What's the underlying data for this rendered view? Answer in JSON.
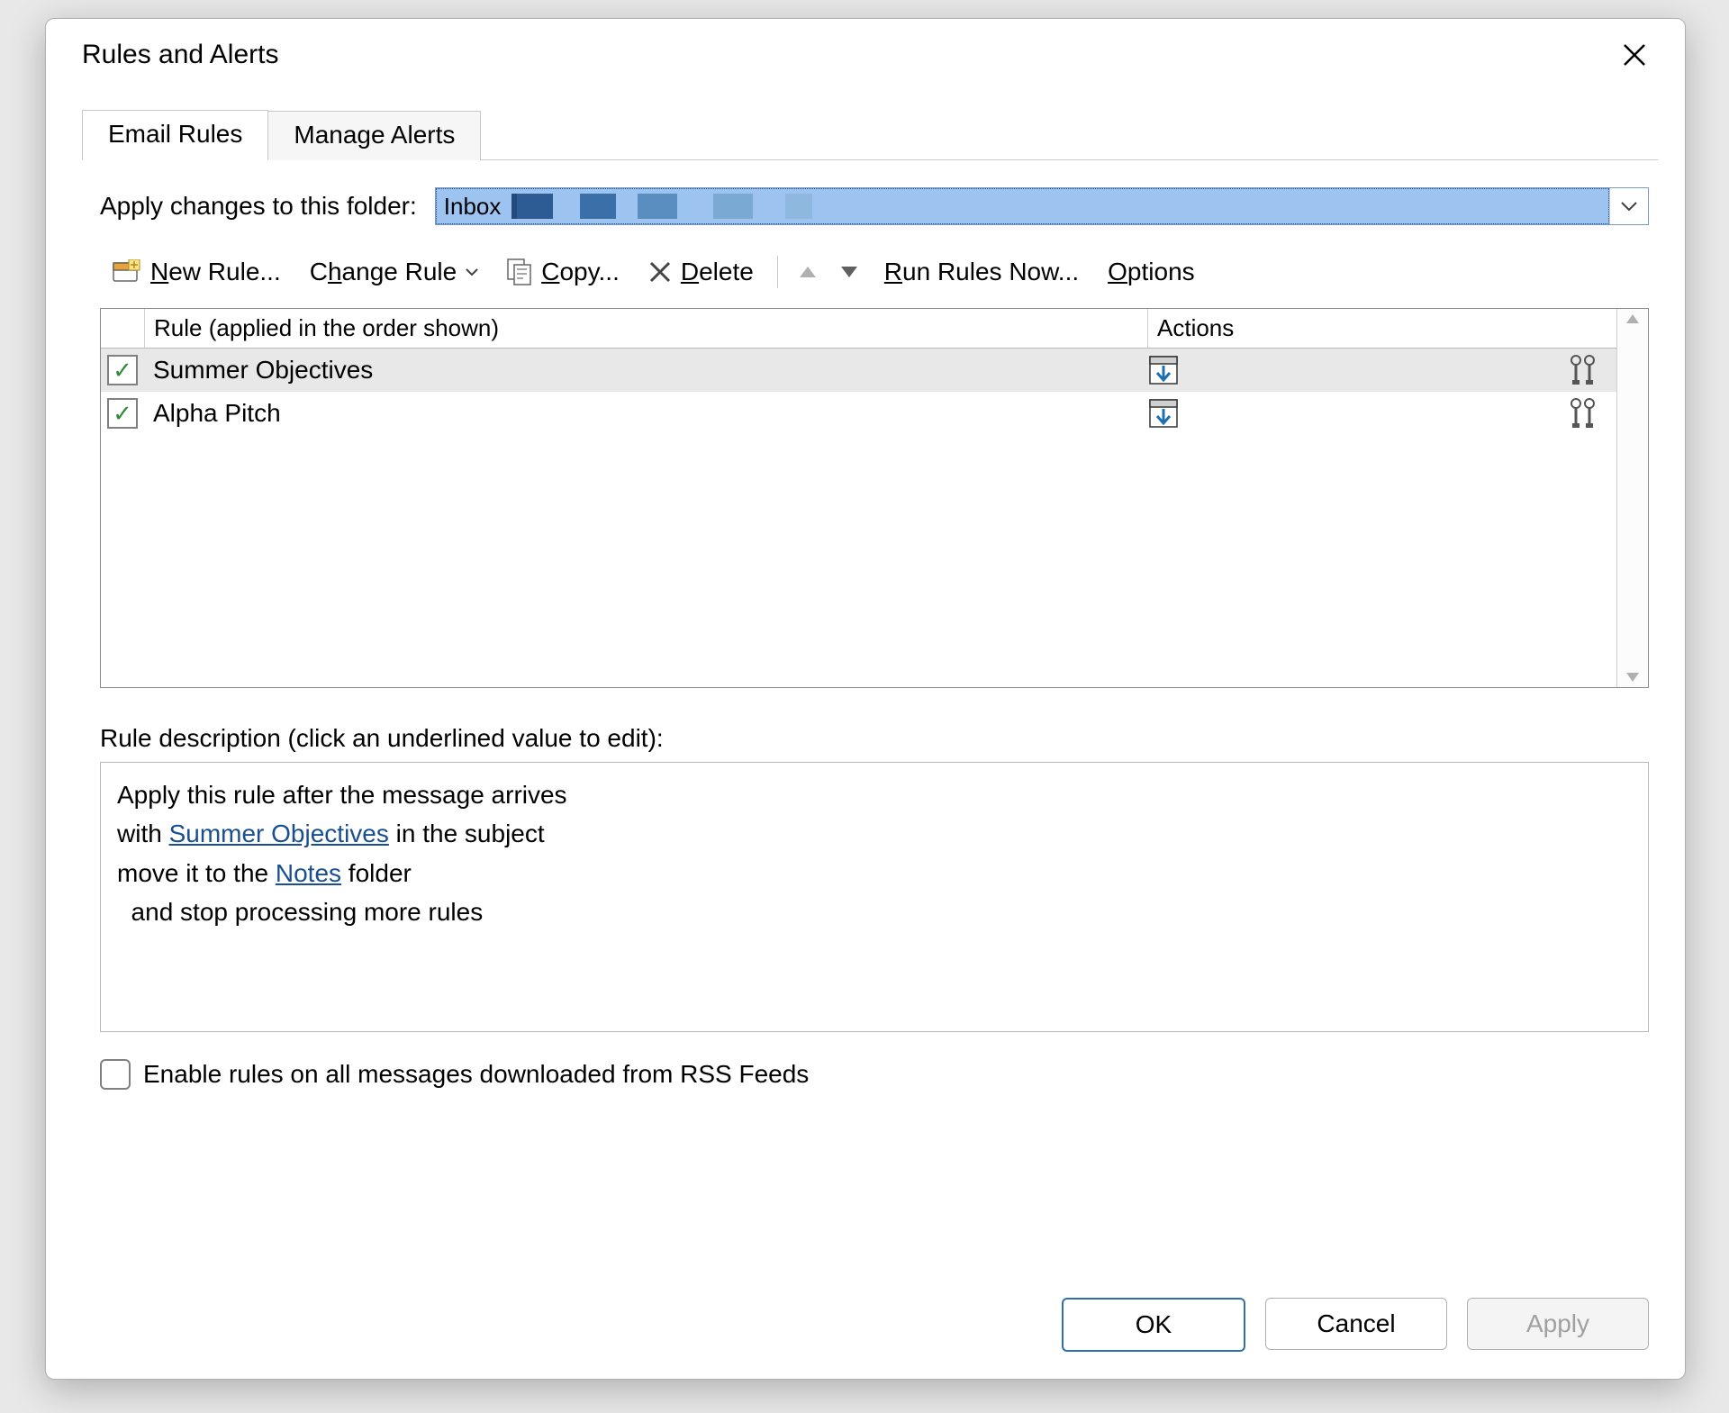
{
  "window": {
    "title": "Rules and Alerts"
  },
  "tabs": {
    "email_rules": "Email Rules",
    "manage_alerts": "Manage Alerts"
  },
  "folder_row": {
    "label": "Apply changes to this folder:",
    "selected": "Inbox"
  },
  "toolbar": {
    "new_rule": "New Rule...",
    "change_rule": "Change Rule",
    "copy": "Copy...",
    "delete": "Delete",
    "run_rules_now": "Run Rules Now...",
    "options": "Options"
  },
  "list": {
    "header_rule": "Rule (applied in the order shown)",
    "header_actions": "Actions",
    "rows": [
      {
        "checked": true,
        "name": "Summer Objectives",
        "selected": true
      },
      {
        "checked": true,
        "name": "Alpha Pitch",
        "selected": false
      }
    ]
  },
  "description": {
    "label": "Rule description (click an underlined value to edit):",
    "line1_pre": "Apply this rule after the message arrives",
    "line2_pre": "with ",
    "line2_link": "Summer Objectives",
    "line2_post": " in the subject",
    "line3_pre": "move it to the ",
    "line3_link": "Notes",
    "line3_post": " folder",
    "line4": " and stop processing more rules"
  },
  "rss_checkbox": {
    "label": "Enable rules on all messages downloaded from RSS Feeds",
    "checked": false
  },
  "buttons": {
    "ok": "OK",
    "cancel": "Cancel",
    "apply": "Apply"
  }
}
